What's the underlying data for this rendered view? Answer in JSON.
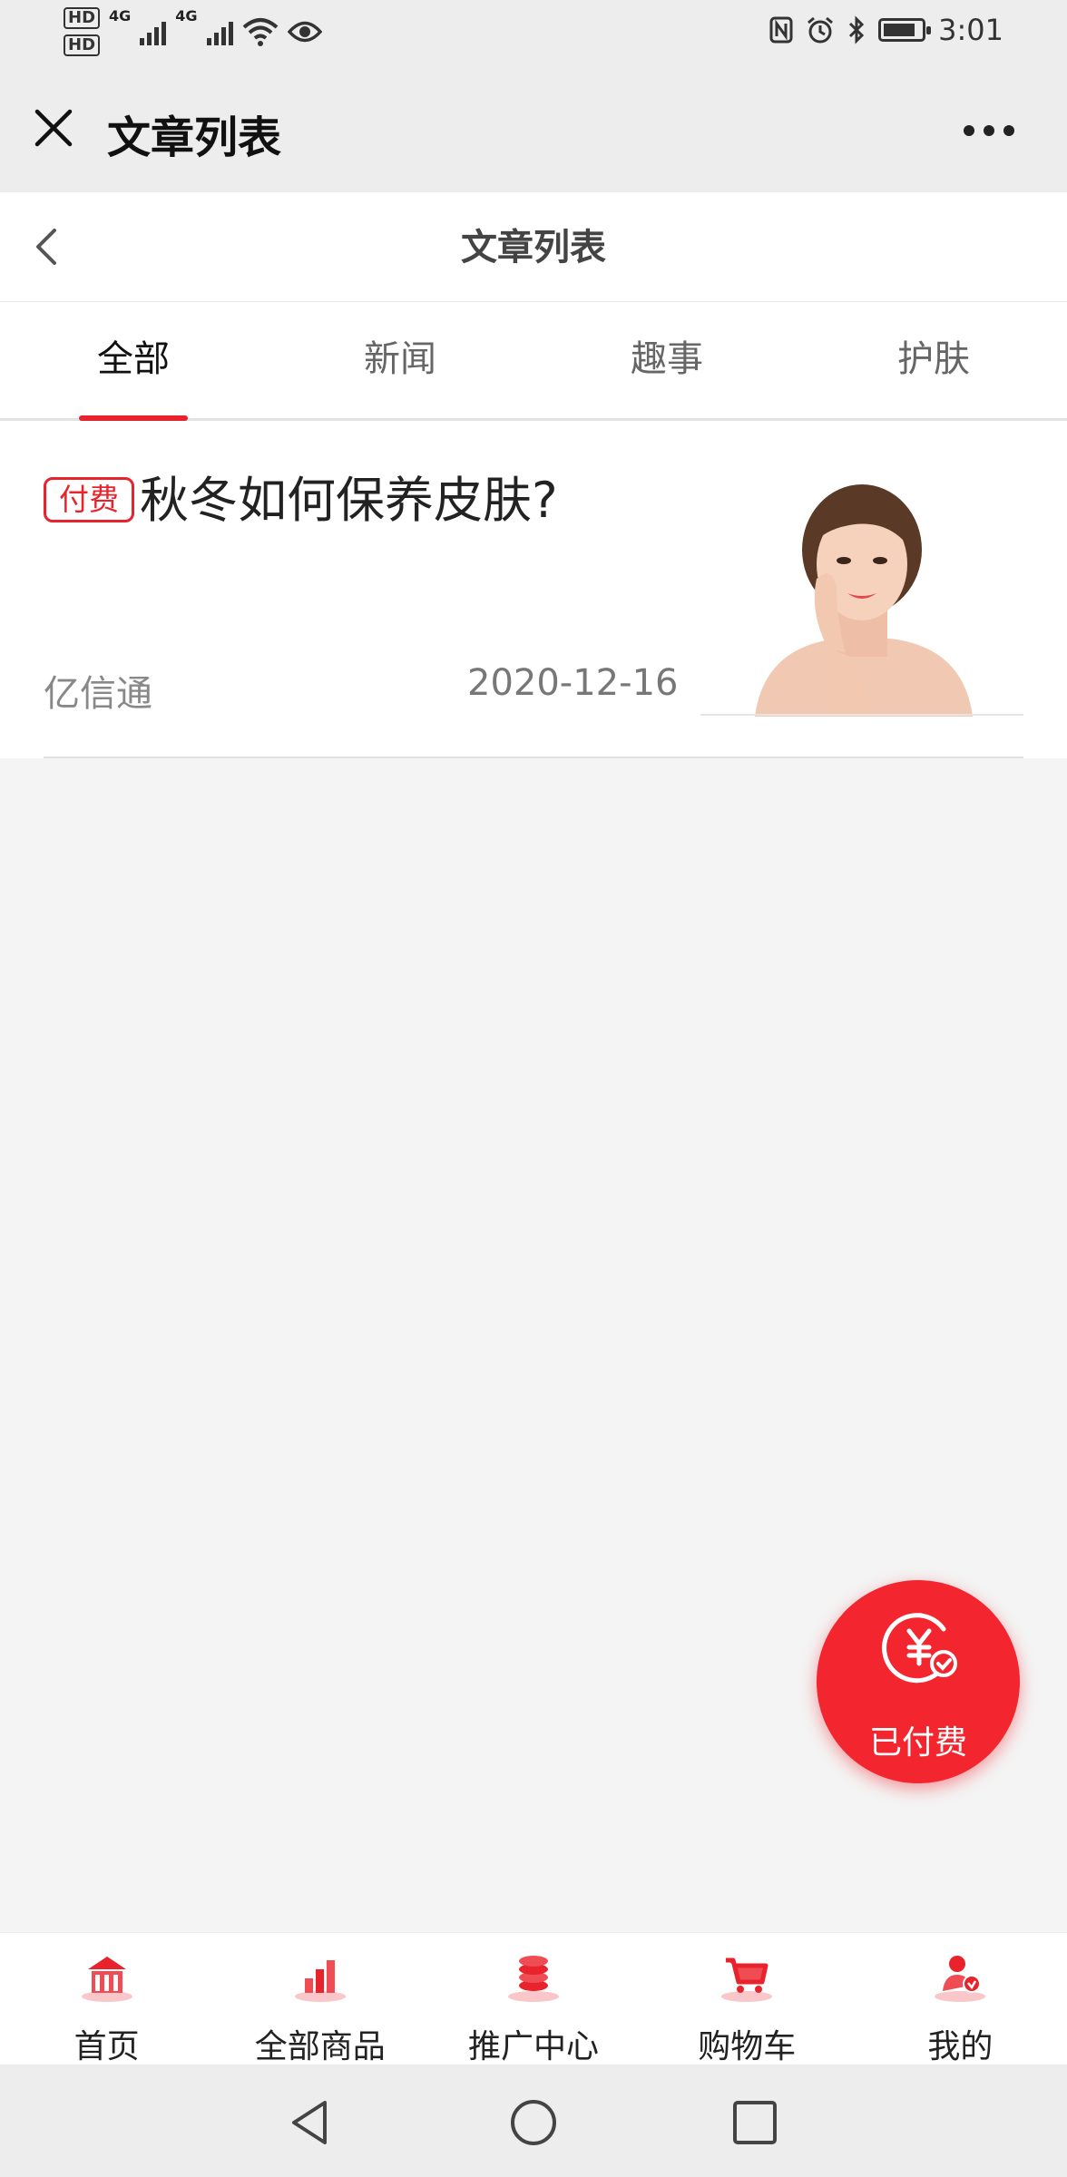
{
  "status_bar": {
    "hd1": "HD",
    "hd2": "HD",
    "net1": "4G",
    "net2": "4G",
    "time": "3:01",
    "battery_level": 0.85
  },
  "title_bar": {
    "title": "文章列表"
  },
  "page_header": {
    "title": "文章列表"
  },
  "tabs": [
    {
      "label": "全部",
      "active": true
    },
    {
      "label": "新闻",
      "active": false
    },
    {
      "label": "趣事",
      "active": false
    },
    {
      "label": "护肤",
      "active": false
    }
  ],
  "articles": [
    {
      "tag": "付费",
      "title": "秋冬如何保养皮肤?",
      "author": "亿信通",
      "date": "2020-12-16"
    }
  ],
  "fab": {
    "label": "已付费"
  },
  "bottom_nav": [
    {
      "label": "首页",
      "icon": "home-icon"
    },
    {
      "label": "全部商品",
      "icon": "products-icon"
    },
    {
      "label": "推广中心",
      "icon": "promotion-icon"
    },
    {
      "label": "购物车",
      "icon": "cart-icon"
    },
    {
      "label": "我的",
      "icon": "profile-icon"
    }
  ],
  "colors": {
    "accent": "#e8232c",
    "fab": "#f3262f"
  }
}
